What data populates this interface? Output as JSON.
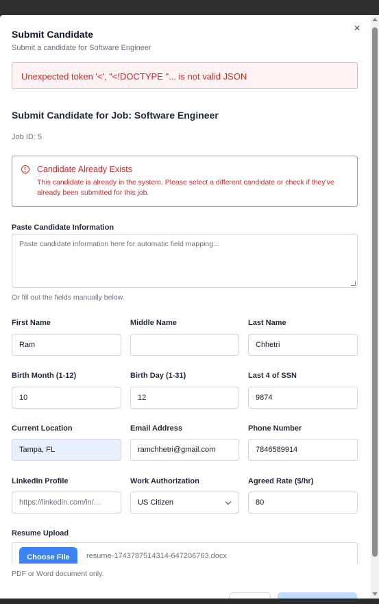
{
  "dialog": {
    "title": "Submit Candidate",
    "subtitle": "Submit a candidate for Software Engineer",
    "close_icon": "×"
  },
  "error_banner": "Unexpected token '<', \"<!DOCTYPE \"... is not valid JSON",
  "form": {
    "heading": "Submit Candidate for Job: Software Engineer",
    "job_id": "Job ID: 5",
    "alert": {
      "title": "Candidate Already Exists",
      "message": "This candidate is already in the system. Please select a different candidate or check if they've already been submitted for this job."
    },
    "paste": {
      "label": "Paste Candidate Information",
      "placeholder": "Paste candidate information here for automatic field mapping...",
      "hint": "Or fill out the fields manually below."
    },
    "fields": {
      "first_name": {
        "label": "First Name",
        "value": "Ram"
      },
      "middle_name": {
        "label": "Middle Name",
        "value": ""
      },
      "last_name": {
        "label": "Last Name",
        "value": "Chhetri"
      },
      "birth_month": {
        "label": "Birth Month (1-12)",
        "value": "10"
      },
      "birth_day": {
        "label": "Birth Day (1-31)",
        "value": "12"
      },
      "ssn_last4": {
        "label": "Last 4 of SSN",
        "value": "9874"
      },
      "location": {
        "label": "Current Location",
        "value": "Tampa, FL"
      },
      "email": {
        "label": "Email Address",
        "value": "ramchhetri@gmail.com"
      },
      "phone": {
        "label": "Phone Number",
        "value": "7846589914"
      },
      "linkedin": {
        "label": "LinkedIn Profile",
        "placeholder": "https://linkedin.com/in/..."
      },
      "work_auth": {
        "label": "Work Authorization",
        "value": "US Citizen"
      },
      "rate": {
        "label": "Agreed Rate ($/hr)",
        "value": "80"
      }
    },
    "resume": {
      "label": "Resume Upload",
      "button": "Choose File",
      "file_name": "resume-1743787514314-647206763.docx",
      "hint": "PDF or Word document only."
    }
  },
  "colors": {
    "accent": "#3b82f6",
    "error": "#dc2626",
    "error_bg": "#fef2f2"
  }
}
